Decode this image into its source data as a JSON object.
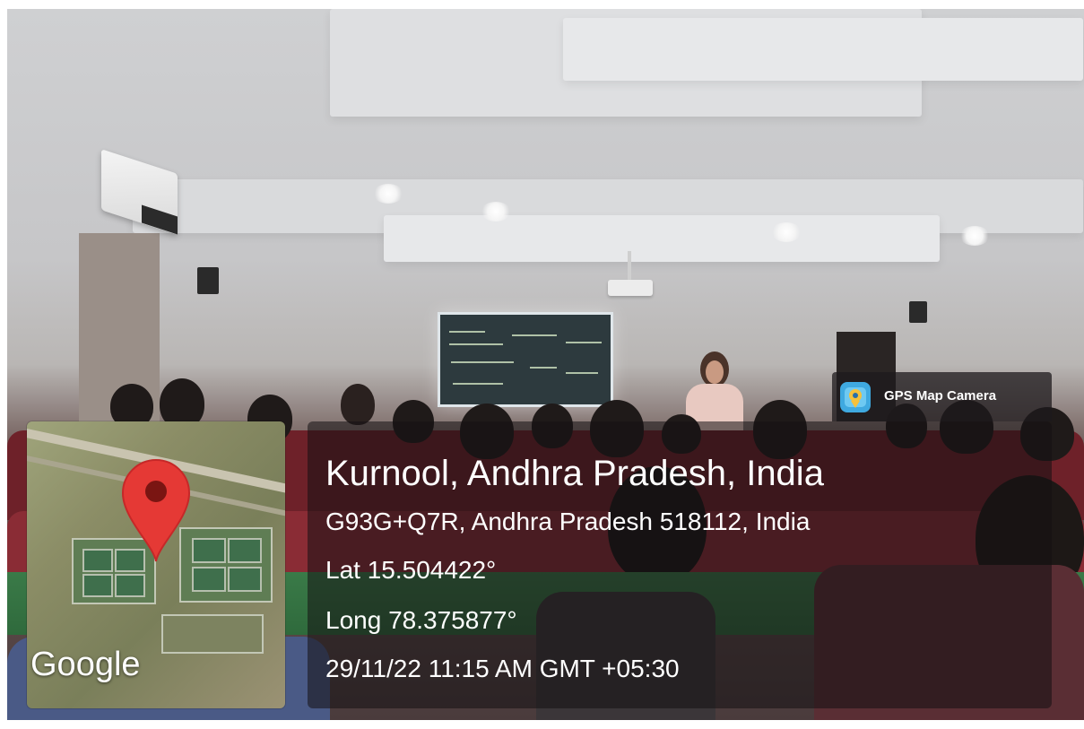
{
  "overlay": {
    "map_logo": "Google",
    "place": "Kurnool, Andhra Pradesh, India",
    "address": "G93G+Q7R, Andhra Pradesh 518112, India",
    "latitude": "Lat 15.504422°",
    "longitude": "Long 78.375877°",
    "timestamp": "29/11/22 11:15 AM GMT +05:30"
  },
  "badge": {
    "app_name": "GPS Map Camera",
    "icon": "gps-map-camera-icon"
  },
  "map": {
    "pin_icon": "map-pin-icon",
    "pin_color": "#e53935"
  },
  "colors": {
    "panel_bg": "rgba(20,16,18,0.55)",
    "text": "#ffffff"
  }
}
